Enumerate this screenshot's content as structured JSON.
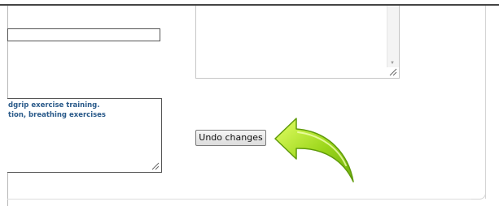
{
  "form": {
    "text_input_value": "",
    "left_textarea": {
      "line1": "dgrip exercise training.",
      "line2": "tion, breathing exercises"
    },
    "right_textarea_value": "",
    "undo_button_label": "Undo changes"
  },
  "annotation": {
    "arrow_color": "#8ccc14",
    "arrow_highlight": "#d8ff55"
  },
  "icons": [
    "resize-grip-icon",
    "scroll-down-arrow-icon",
    "green-curved-arrow-icon"
  ]
}
